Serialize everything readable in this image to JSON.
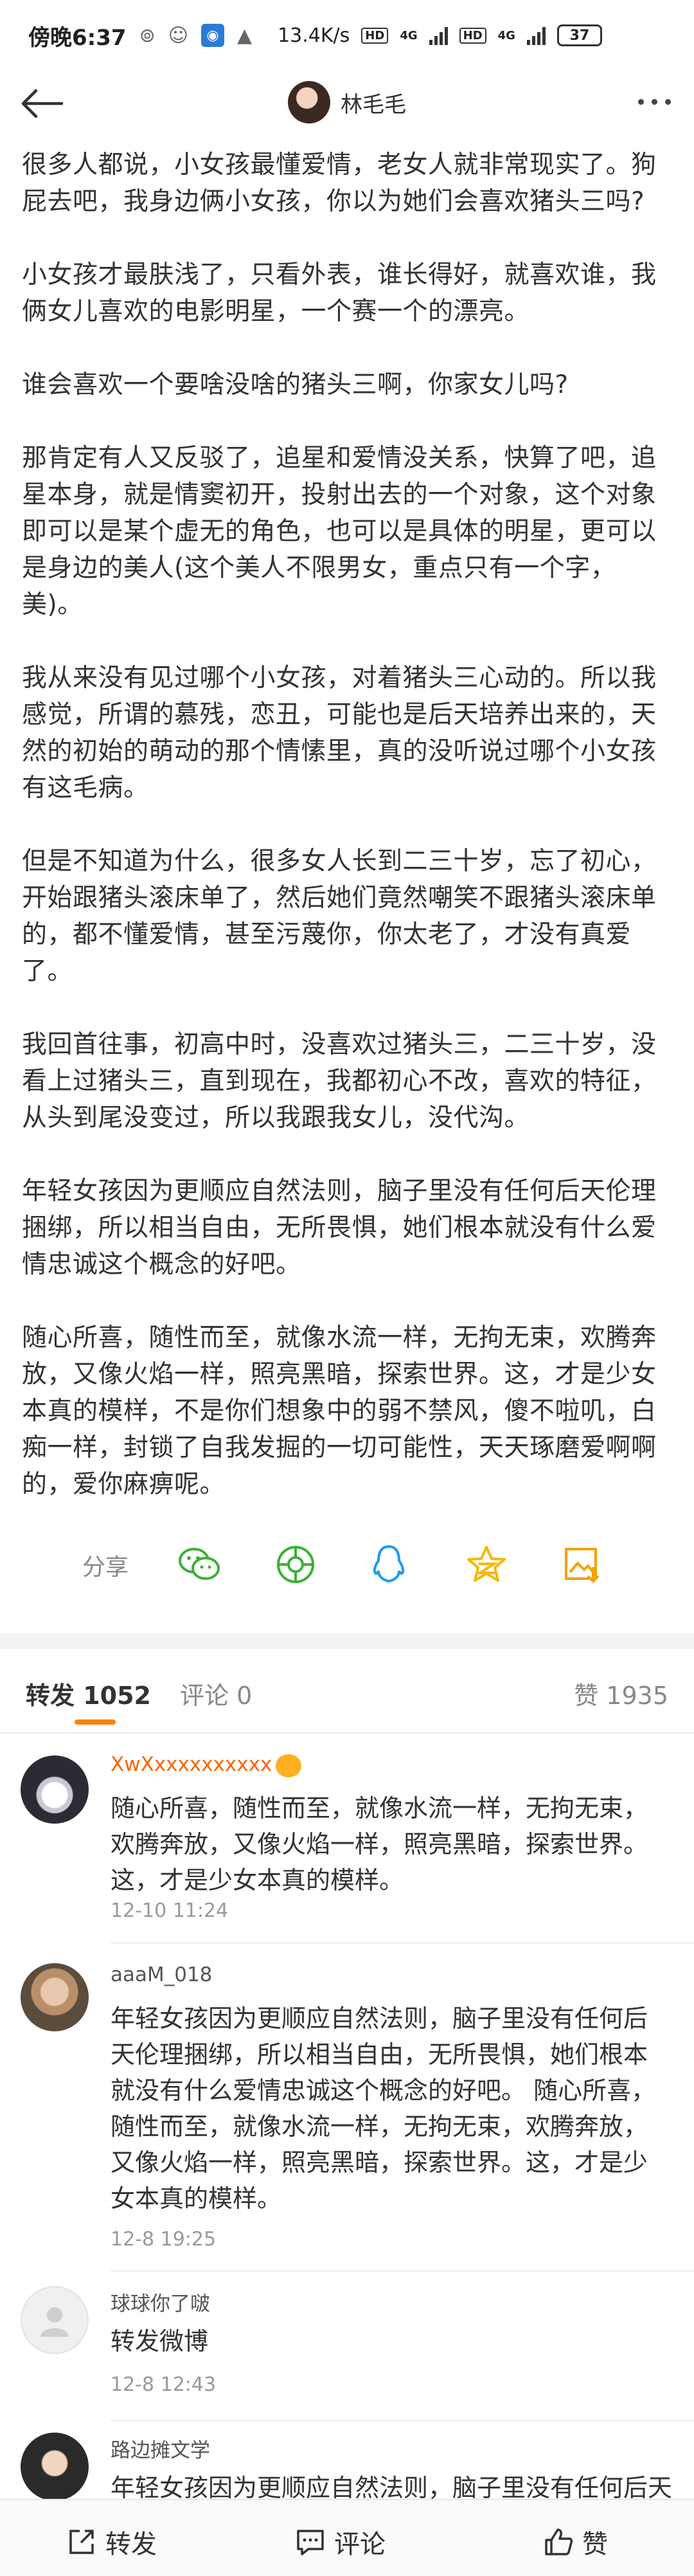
{
  "status_bar": {
    "time": "傍晚6:37",
    "speed": "13.4K/s",
    "hd": "HD",
    "net": "4G",
    "hd2": "HD",
    "net2": "4G",
    "battery": "37"
  },
  "nav": {
    "title": "林毛毛",
    "back_icon": "arrow-left-icon",
    "more_icon": "more-dots-icon"
  },
  "article": {
    "paragraphs": [
      "很多人都说，小女孩最懂爱情，老女人就非常现实了。狗屁去吧，我身边俩小女孩，你以为她们会喜欢猪头三吗?",
      "小女孩才最肤浅了，只看外表，谁长得好，就喜欢谁，我俩女儿喜欢的电影明星，一个赛一个的漂亮。",
      "谁会喜欢一个要啥没啥的猪头三啊，你家女儿吗?",
      "那肯定有人又反驳了，追星和爱情没关系，快算了吧，追星本身，就是情窦初开，投射出去的一个对象，这个对象即可以是某个虚无的角色，也可以是具体的明星，更可以是身边的美人(这个美人不限男女，重点只有一个字，美)。",
      "我从来没有见过哪个小女孩，对着猪头三心动的。所以我感觉，所谓的慕残，恋丑，可能也是后天培养出来的，天然的初始的萌动的那个情愫里，真的没听说过哪个小女孩有这毛病。",
      "但是不知道为什么，很多女人长到二三十岁，忘了初心，开始跟猪头滚床单了，然后她们竟然嘲笑不跟猪头滚床单的，都不懂爱情，甚至污蔑你，你太老了，才没有真爱了。",
      "我回首往事，初高中时，没喜欢过猪头三，二三十岁，没看上过猪头三，直到现在，我都初心不改，喜欢的特征，从头到尾没变过，所以我跟我女儿，没代沟。",
      "年轻女孩因为更顺应自然法则，脑子里没有任何后天伦理捆绑，所以相当自由，无所畏惧，她们根本就没有什么爱情忠诚这个概念的好吧。",
      "随心所喜，随性而至，就像水流一样，无拘无束，欢腾奔放，又像火焰一样，照亮黑暗，探索世界。这，才是少女本真的模样，不是你们想象中的弱不禁风，傻不啦叽，白痴一样，封锁了自我发掘的一切可能性，天天琢磨爱啊啊的，爱你麻痹呢。"
    ]
  },
  "share": {
    "label": "分享",
    "icons": [
      "wechat-icon",
      "moments-icon",
      "qq-icon",
      "qzone-icon",
      "save-image-icon"
    ],
    "colors": [
      "#3cb034",
      "#3cb034",
      "#1e9bf0",
      "#f5b800",
      "#f5a300"
    ]
  },
  "tabs": {
    "repost": "转发 1052",
    "comment": "评论 0",
    "like": "赞 1935",
    "accent": "#ff8200"
  },
  "comments": [
    {
      "name": "XwXxxxxxxxxxx",
      "vip": true,
      "text": "随心所喜，随性而至，就像水流一样，无拘无束，欢腾奔放，又像火焰一样，照亮黑暗，探索世界。这，才是少女本真的模样。",
      "time": "12-10 11:24"
    },
    {
      "name": "aaaM_018",
      "vip": false,
      "text": "年轻女孩因为更顺应自然法则，脑子里没有任何后天伦理捆绑，所以相当自由，无所畏惧，她们根本就没有什么爱情忠诚这个概念的好吧。 随心所喜，随性而至，就像水流一样，无拘无束，欢腾奔放，又像火焰一样，照亮黑暗，探索世界。这，才是少女本真的模样。",
      "time": "12-8 19:25"
    },
    {
      "name": "球球你了啵",
      "vip": false,
      "text": "转发微博",
      "time": "12-8 12:43"
    },
    {
      "name": "路边摊文学",
      "vip": false,
      "text": "年轻女孩因为更顺应自然法则，脑子里没有任何后天伦理捆绑，",
      "time": ""
    }
  ],
  "bottom_bar": {
    "repost": "转发",
    "comment": "评论",
    "like": "赞"
  }
}
